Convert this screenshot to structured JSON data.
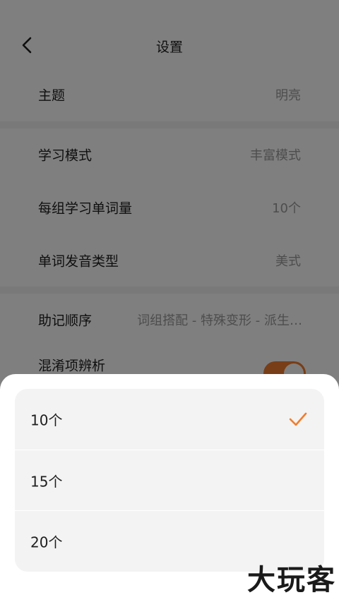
{
  "header": {
    "title": "设置",
    "back_icon": "chevron-left-icon"
  },
  "settings": {
    "theme": {
      "label": "主题",
      "value": "明亮"
    },
    "study_mode": {
      "label": "学习模式",
      "value": "丰富模式"
    },
    "words_per_group": {
      "label": "每组学习单词量",
      "value": "10个"
    },
    "pronunciation": {
      "label": "单词发音类型",
      "value": "美式"
    },
    "mnemonic_order": {
      "label": "助记顺序",
      "value": "词组搭配 - 特殊变形 - 派生…"
    },
    "confusion_analysis": {
      "label": "混淆项辨析",
      "toggle_on": true
    }
  },
  "sheet": {
    "options": [
      {
        "label": "10个",
        "selected": true
      },
      {
        "label": "15个",
        "selected": false
      },
      {
        "label": "20个",
        "selected": false
      }
    ],
    "check_icon": "checkmark-icon"
  },
  "colors": {
    "accent": "#f07d2e",
    "overlay": "rgba(0,0,0,0.5)"
  },
  "watermark": "大玩客"
}
